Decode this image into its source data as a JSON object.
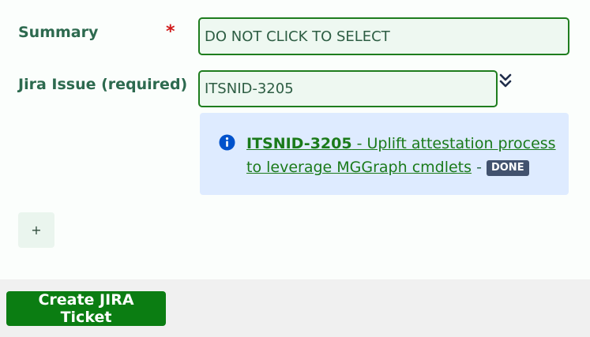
{
  "form": {
    "summary": {
      "label": "Summary",
      "required_marker": "*",
      "value": "DO NOT CLICK TO SELECT"
    },
    "jira_issue": {
      "label": "Jira Issue (required)",
      "value": "ITSNID-3205",
      "expand_icon": "double-chevron-down-icon"
    },
    "issue_preview": {
      "icon": "info-icon",
      "issue_key": "ITSNID-3205",
      "title_link": " - Uplift attestation process to leverage MGGraph cmdlets",
      "separator": " - ",
      "status": "DONE"
    },
    "add_button_label": "+"
  },
  "footer": {
    "create_button_label": "Create JIRA Ticket"
  },
  "colors": {
    "accent_green": "#0b7d12",
    "label_green": "#2d6a4f",
    "required_red": "#d11a1a",
    "info_background": "#deebff",
    "info_icon_blue": "#0052cc",
    "status_lozenge": "#42526e"
  }
}
